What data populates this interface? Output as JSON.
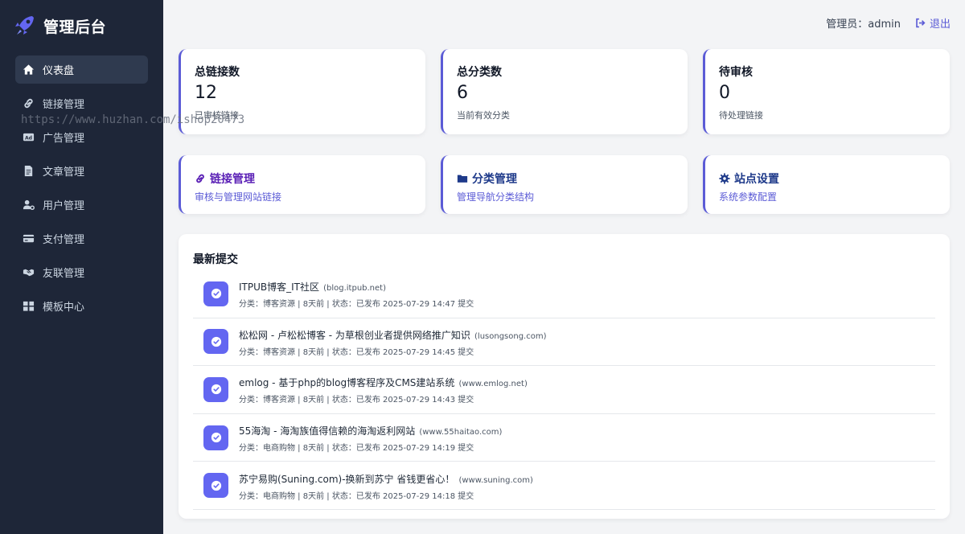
{
  "brand": {
    "title": "管理后台",
    "icon": "rocket-icon"
  },
  "watermark": "https://www.huzhan.com/ishop20473",
  "sidebar": {
    "items": [
      {
        "label": "仪表盘",
        "icon": "home-icon",
        "active": true
      },
      {
        "label": "链接管理",
        "icon": "link-icon"
      },
      {
        "label": "广告管理",
        "icon": "ad-icon"
      },
      {
        "label": "文章管理",
        "icon": "file-icon"
      },
      {
        "label": "用户管理",
        "icon": "user-gear-icon"
      },
      {
        "label": "支付管理",
        "icon": "credit-card-icon"
      },
      {
        "label": "友联管理",
        "icon": "handshake-icon"
      },
      {
        "label": "模板中心",
        "icon": "grid-icon"
      }
    ]
  },
  "topbar": {
    "admin_label": "管理员：admin",
    "logout_label": "退出"
  },
  "stats": [
    {
      "title": "总链接数",
      "value": "12",
      "desc": "已审核链接"
    },
    {
      "title": "总分类数",
      "value": "6",
      "desc": "当前有效分类"
    },
    {
      "title": "待审核",
      "value": "0",
      "desc": "待处理链接"
    }
  ],
  "quick": [
    {
      "title": "链接管理",
      "desc": "审核与管理网站链接",
      "icon": "link-icon",
      "color": "#5b21b6"
    },
    {
      "title": "分类管理",
      "desc": "管理导航分类结构",
      "icon": "folder-icon",
      "color": "#1e3a8a"
    },
    {
      "title": "站点设置",
      "desc": "系统参数配置",
      "icon": "gear-icon",
      "color": "#1e3a8a"
    }
  ],
  "recent": {
    "title": "最新提交",
    "items": [
      {
        "name": "ITPUB博客_IT社区",
        "domain": "(blog.itpub.net)",
        "meta": "分类：博客资源 | 8天前 | 状态：已发布 2025-07-29 14:47 提交"
      },
      {
        "name": "松松网 - 卢松松博客 - 为草根创业者提供网络推广知识",
        "domain": "(lusongsong.com)",
        "meta": "分类：博客资源 | 8天前 | 状态：已发布 2025-07-29 14:45 提交"
      },
      {
        "name": "emlog - 基于php的blog博客程序及CMS建站系统",
        "domain": "(www.emlog.net)",
        "meta": "分类：博客资源 | 8天前 | 状态：已发布 2025-07-29 14:43 提交"
      },
      {
        "name": "55海淘 - 海淘族值得信赖的海淘返利网站",
        "domain": "(www.55haitao.com)",
        "meta": "分类：电商购物 | 8天前 | 状态：已发布 2025-07-29 14:19 提交"
      },
      {
        "name": "苏宁易购(Suning.com)-换新到苏宁 省钱更省心！",
        "domain": "(www.suning.com)",
        "meta": "分类：电商购物 | 8天前 | 状态：已发布 2025-07-29 14:18 提交"
      }
    ]
  },
  "colors": {
    "accent": "#5b5bd6",
    "sidebar_bg": "#1e2638",
    "check_bg": "#6366f1"
  }
}
